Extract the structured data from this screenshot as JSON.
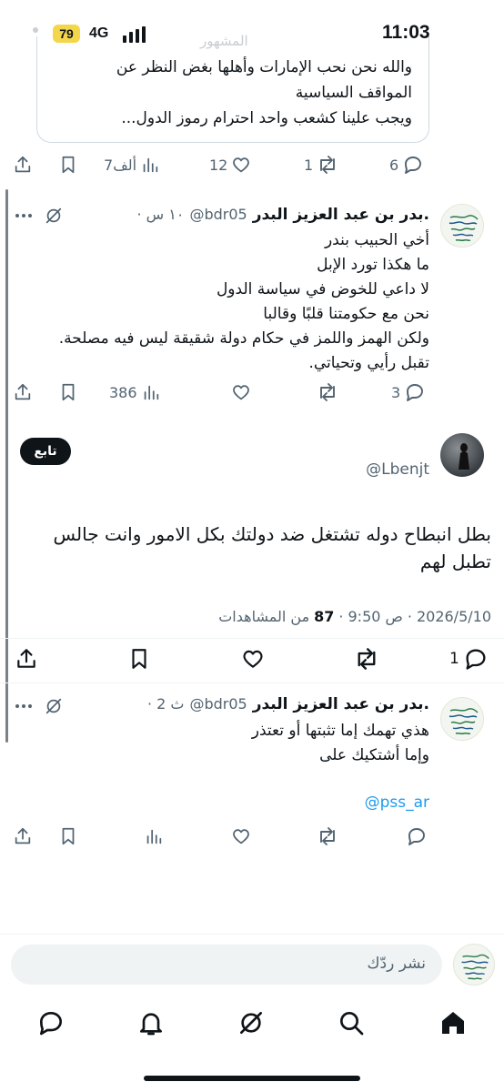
{
  "status_bar": {
    "time": "11:03",
    "battery": "79",
    "network": "4G",
    "faded_header": "المشهور"
  },
  "quoted_post": {
    "lines": [
      "والله نحن نحب الإمارات وأهلها بغض النظر عن",
      "المواقف السياسية",
      "ويجب علينا كشعب واحد احترام رموز الدول..."
    ],
    "actions": {
      "replies": "6",
      "reposts": "1",
      "likes": "12",
      "views": "7ألف"
    }
  },
  "reply_1": {
    "author_name": "بدر بن عبد العزيز البدر.",
    "handle": "@bdr05",
    "time": "· ١٠ س",
    "lines": [
      "أخي الحبيب بندر",
      "ما هكذا تورد الإبل",
      "لا داعي للخوض في سياسة الدول",
      "نحن مع حكومتنا قلبًا وقالبا",
      "ولكن الهمز واللمز في حكام دولة شقيقة ليس فيه مصلحة.",
      "تقبل رأيي وتحياتي."
    ],
    "actions": {
      "replies": "3",
      "reposts": "",
      "likes": "",
      "views": "386"
    }
  },
  "main_post": {
    "handle": "@Lbenjt",
    "follow_label": "تابع",
    "text_lines": [
      "بطل انبطاح دوله تشتغل ضد دولتك بكل الامور وانت جالس",
      "تطبل لهم"
    ],
    "date": "2026/5/10",
    "time": "9:50 ص",
    "views_count": "87",
    "views_label": "من المشاهدات",
    "actions": {
      "replies": "1"
    }
  },
  "reply_2": {
    "author_name": "بدر بن عبد العزيز البدر.",
    "handle": "@bdr05",
    "time": "· 2 ث",
    "lines": [
      "هذي تهمك إما تثبتها أو تعتذر",
      "وإما أشتكيك على"
    ],
    "mention": "@pss_ar"
  },
  "reply_composer": {
    "placeholder": "نشر ردّك"
  },
  "tab_bar": {
    "items": [
      "home-icon",
      "search-icon",
      "grok-icon",
      "notifications-icon",
      "messages-icon"
    ]
  },
  "colors": {
    "accent": "#1d9bf0",
    "text": "#0f1419",
    "muted": "#536471",
    "battery": "#f4d64a"
  }
}
